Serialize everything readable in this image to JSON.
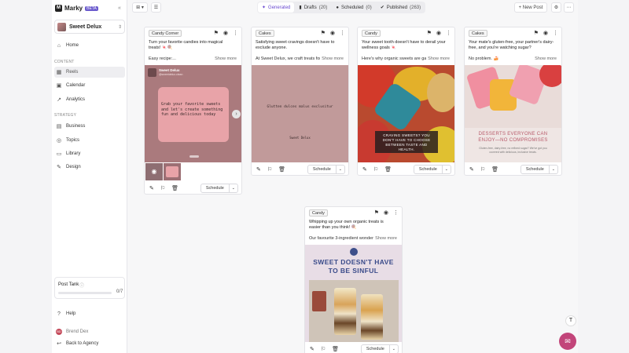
{
  "app": {
    "name": "Marky",
    "badge": "BETA"
  },
  "workspace": {
    "name": "Sweet Delux"
  },
  "nav": {
    "home": "Home",
    "section_content": "CONTENT",
    "reels": "Reels",
    "calendar": "Calendar",
    "analytics": "Analytics",
    "section_strategy": "STRATEGY",
    "business": "Business",
    "topics": "Topics",
    "library": "Library",
    "design": "Design"
  },
  "post_tank": {
    "label": "Post Tank",
    "count": "0/7",
    "fill_fraction": 0
  },
  "sidebar_bottom": {
    "help": "Help",
    "user": "Brend Dex",
    "user_initials": "BD",
    "back": "Back to Agency"
  },
  "tabs": [
    {
      "label": "Generated",
      "count": ""
    },
    {
      "label": "Drafts",
      "count": "(20)"
    },
    {
      "label": "Scheduled",
      "count": "(0)"
    },
    {
      "label": "Published",
      "count": "(263)"
    }
  ],
  "toolbar": {
    "new_post": "+ New Post"
  },
  "show_more": "Show more",
  "schedule_label": "Schedule",
  "cards": [
    {
      "tag": "Candy Corner",
      "caption": "Turn your favorite candies into magical treats! 🍬🍭",
      "caption2": "Easy recipe:...",
      "media": {
        "brand": "Sweet Delux",
        "handle": "@sweetdelux.clean",
        "text": "Grab your favorite sweets and let's create something fun and delicious today"
      }
    },
    {
      "tag": "Cakes",
      "caption": "Satisfying sweet cravings doesn't have to exclude anyone.",
      "caption2": "At Sweet Delux, we craft treats for...",
      "media": {
        "text": "Glutten dulces malus exclusitur",
        "brand": "Sweet Delux"
      }
    },
    {
      "tag": "Candy",
      "caption": "Your sweet tooth doesn't have to derail your wellness goals 🍬",
      "caption2": "Here's why organic sweets are game-...",
      "media": {
        "text": "CRAVING SWEETS? YOU DON'T HAVE TO CHOOSE BETWEEN TASTE AND HEALTH."
      }
    },
    {
      "tag": "Cakes",
      "caption": "Your mate's gluten-free, your partner's dairy-free, and you're watching sugar?",
      "caption2": "No problem. 🍰",
      "media": {
        "headline": "DESSERTS EVERYONE CAN ENJOY—NO COMPROMISES",
        "sub": "Gluten-free, dairy-free, no refined sugar? We've got you covered with delicious, inclusive treats."
      }
    },
    {
      "tag": "Candy",
      "caption": "Whipping up your own organic treats is easier than you think! 🍭",
      "caption2": "Our favourite 3-ingredient wonders:...",
      "media": {
        "headline": "SWEET DOESN'T HAVE TO BE SINFUL"
      }
    }
  ]
}
